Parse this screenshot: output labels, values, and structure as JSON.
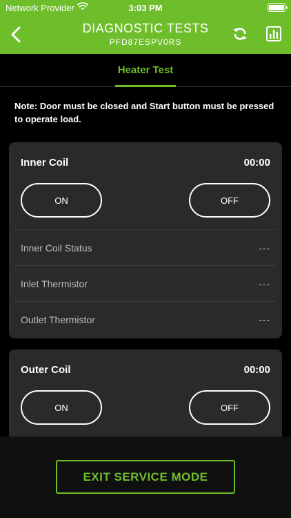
{
  "status_bar": {
    "provider": "Network Provider",
    "time": "3:03 PM"
  },
  "header": {
    "title": "DIAGNOSTIC TESTS",
    "subtitle": "PFD87ESPV0RS",
    "color": "#6ebd2b"
  },
  "tabs": [
    {
      "label": "Heater Test",
      "active": true
    }
  ],
  "note": "Note: Door must be closed and Start button must be pressed to operate load.",
  "cards": [
    {
      "title": "Inner Coil",
      "timer": "00:00",
      "on_label": "ON",
      "off_label": "OFF",
      "rows": [
        {
          "label": "Inner Coil Status",
          "value": "---"
        },
        {
          "label": "Inlet Thermistor",
          "value": "---"
        },
        {
          "label": "Outlet Thermistor",
          "value": "---"
        }
      ]
    },
    {
      "title": "Outer Coil",
      "timer": "00:00",
      "on_label": "ON",
      "off_label": "OFF"
    }
  ],
  "exit_button": "EXIT SERVICE MODE",
  "icons": {
    "back": "chevron-left-icon",
    "refresh": "refresh-icon",
    "report": "bar-chart-icon"
  }
}
